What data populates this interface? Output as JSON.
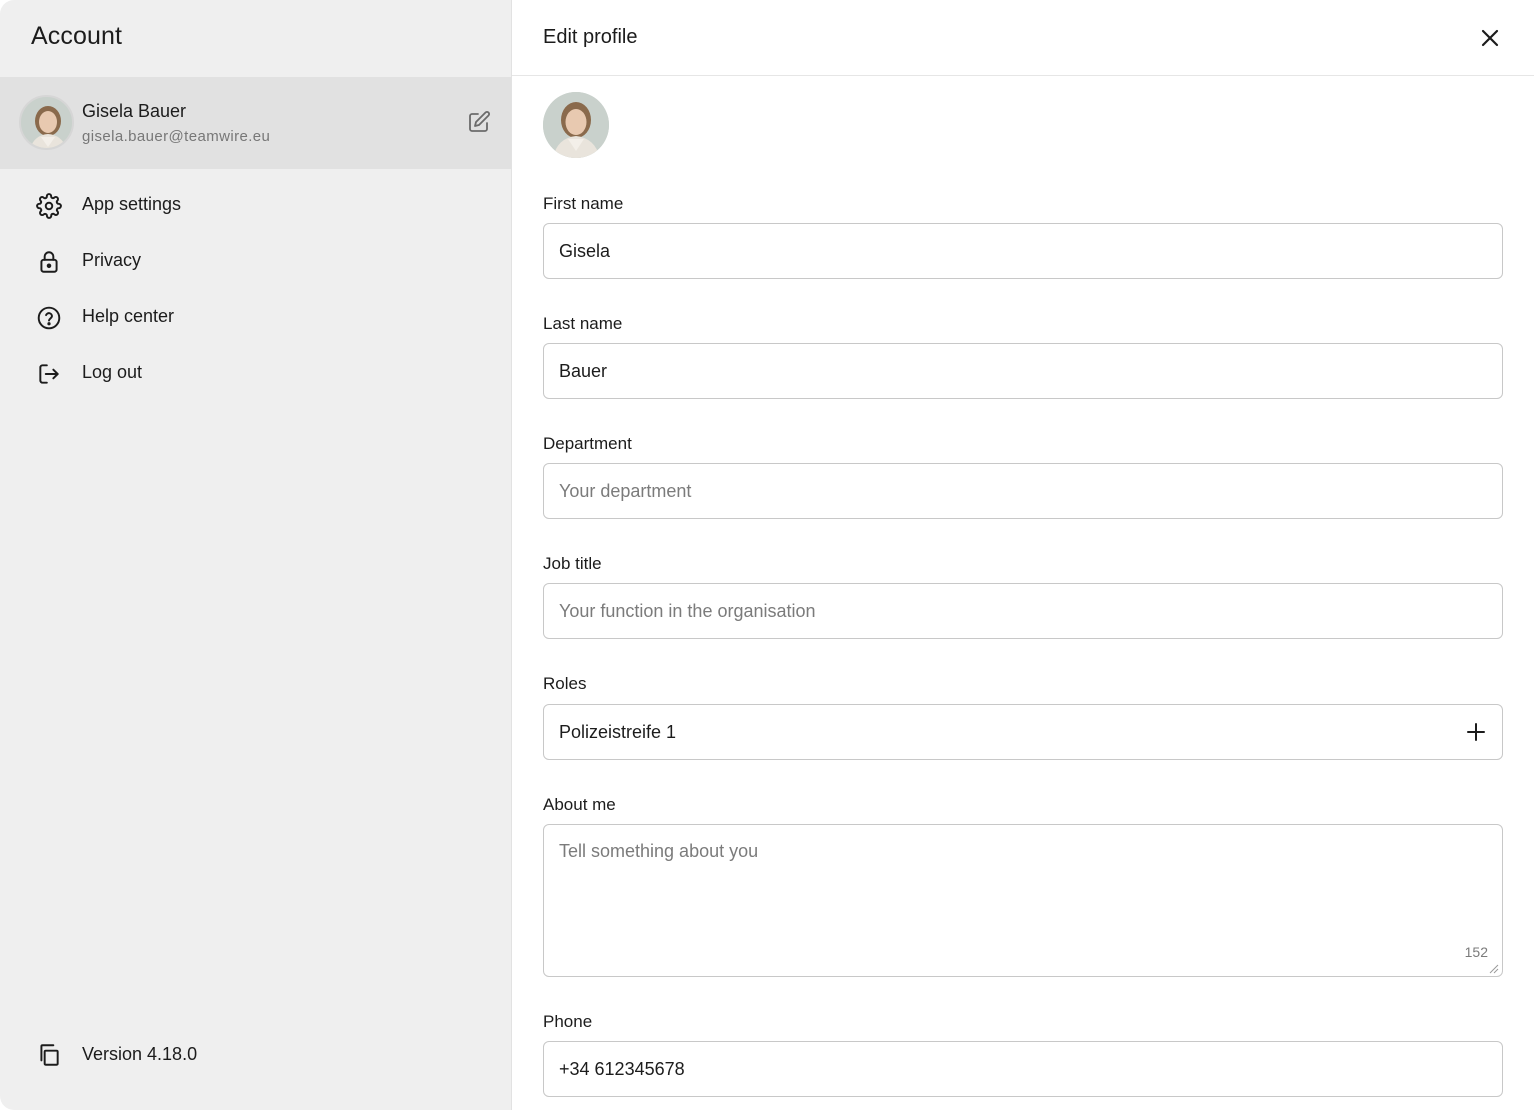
{
  "sidebar": {
    "title": "Account",
    "profile": {
      "name": "Gisela Bauer",
      "email": "gisela.bauer@teamwire.eu"
    },
    "menu": [
      {
        "label": "App settings",
        "icon": "gear-icon"
      },
      {
        "label": "Privacy",
        "icon": "lock-icon"
      },
      {
        "label": "Help center",
        "icon": "help-circle-icon"
      },
      {
        "label": "Log out",
        "icon": "logout-icon"
      }
    ],
    "version": "Version 4.18.0"
  },
  "editor": {
    "title": "Edit profile",
    "fields": {
      "first_name": {
        "label": "First name",
        "value": "Gisela"
      },
      "last_name": {
        "label": "Last name",
        "value": "Bauer"
      },
      "department": {
        "label": "Department",
        "value": "",
        "placeholder": "Your department"
      },
      "job_title": {
        "label": "Job title",
        "value": "",
        "placeholder": "Your function in the organisation"
      },
      "roles": {
        "label": "Roles",
        "value": "Polizeistreife 1"
      },
      "about": {
        "label": "About me",
        "value": "",
        "placeholder": "Tell something about you",
        "remaining": "152"
      },
      "phone": {
        "label": "Phone",
        "value": "+34 612345678"
      }
    }
  },
  "colors": {
    "sidebar_bg": "#efefef",
    "selected_bg": "#e1e1e1",
    "border": "#c8c8c8"
  }
}
